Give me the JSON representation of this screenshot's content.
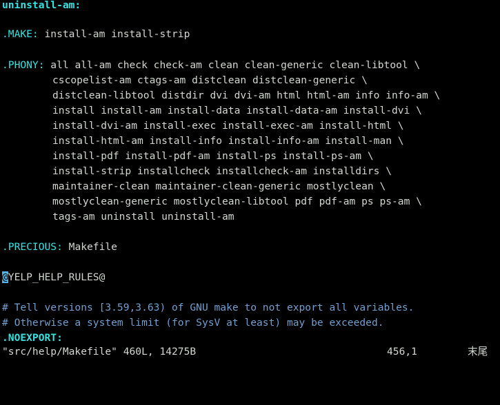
{
  "editor": {
    "top_target": "uninstall-am:",
    "make_target": ".MAKE:",
    "make_deps": " install-am install-strip",
    "phony_target": ".PHONY:",
    "phony_first": " all all-am check check-am clean clean-generic clean-libtool \\",
    "phony_lines": [
      "cscopelist-am ctags-am distclean distclean-generic \\",
      "distclean-libtool distdir dvi dvi-am html html-am info info-am \\",
      "install install-am install-data install-data-am install-dvi \\",
      "install-dvi-am install-exec install-exec-am install-html \\",
      "install-html-am install-info install-info-am install-man \\",
      "install-pdf install-pdf-am install-ps install-ps-am \\",
      "install-strip installcheck installcheck-am installdirs \\",
      "maintainer-clean maintainer-clean-generic mostlyclean \\",
      "mostlyclean-generic mostlyclean-libtool pdf pdf-am ps ps-am \\",
      "tags-am uninstall uninstall-am"
    ],
    "precious_target": ".PRECIOUS:",
    "precious_deps": " Makefile",
    "cursor_char": "@",
    "yelp_rest": "YELP_HELP_RULES@",
    "comment_1": "# Tell versions [3.59,3.63) of GNU make to not export all variables.",
    "comment_2": "# Otherwise a system limit (for SysV at least) may be exceeded.",
    "noexport": ".NOEXPORT:"
  },
  "status": {
    "file_info": "\"src/help/Makefile\" 460L, 14275B",
    "position": "456,1",
    "scroll": "末尾"
  },
  "colors": {
    "background": "#000000",
    "text": "#d3d7cf",
    "target": "#34e2e2",
    "comment": "#729fcf",
    "cursor": "#4fb3e8"
  }
}
